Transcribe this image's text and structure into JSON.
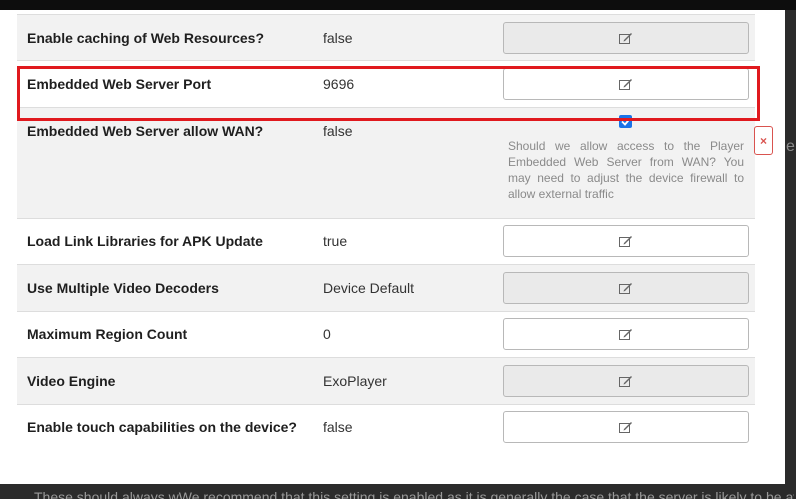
{
  "settings": {
    "rows": [
      {
        "label": "Enable caching of Web Resources?",
        "value": "false"
      },
      {
        "label": "Embedded Web Server Port",
        "value": "9696"
      },
      {
        "label": "Embedded Web Server allow WAN?",
        "value": "false",
        "checked": true,
        "help": "Should we allow access to the Player Embedded Web Server from WAN? You may need to adjust the device firewall to allow external traffic"
      },
      {
        "label": "Load Link Libraries for APK Update",
        "value": "true"
      },
      {
        "label": "Use Multiple Video Decoders",
        "value": "Device Default"
      },
      {
        "label": "Maximum Region Count",
        "value": "0"
      },
      {
        "label": "Video Engine",
        "value": "ExoPlayer"
      },
      {
        "label": "Enable touch capabilities on the device?",
        "value": "false"
      }
    ]
  },
  "icons": {
    "edit": "edit-icon",
    "close": "close-icon",
    "check": "check-icon"
  },
  "close_label": "×",
  "backdrop": {
    "bottom_text": "These should always wWe recommend that this setting is enabled as it is generally the case that the server is likely to be available",
    "edge_letter": "e"
  },
  "colors": {
    "highlight": "#e0191e",
    "checkbox": "#1a73e8",
    "close": "#d9534f"
  }
}
